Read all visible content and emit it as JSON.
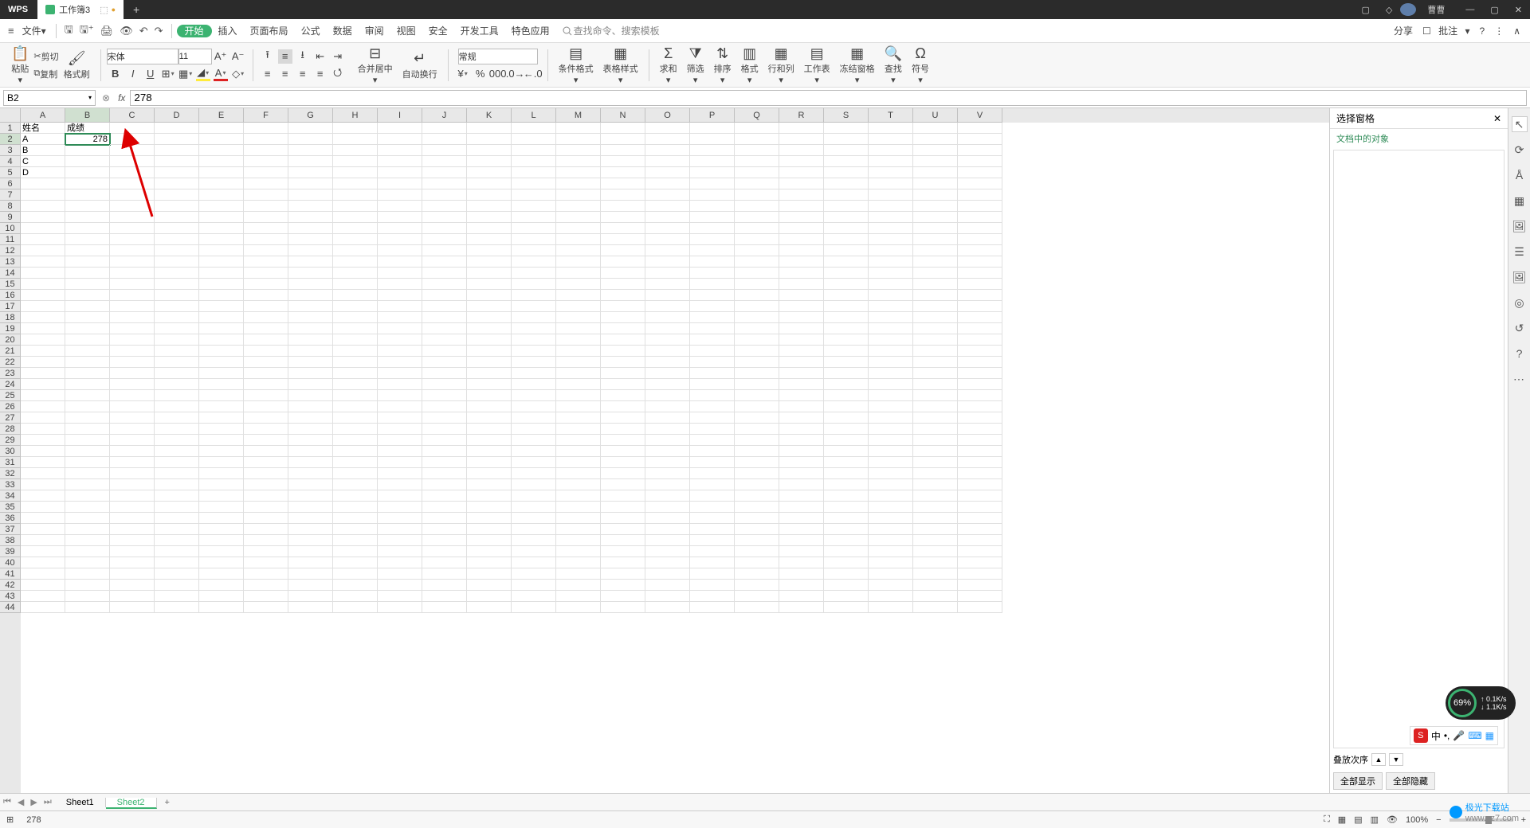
{
  "title": {
    "app": "WPS",
    "workbook": "工作簿3",
    "user": "曹曹"
  },
  "menu": {
    "file": "文件",
    "tabs": [
      "开始",
      "插入",
      "页面布局",
      "公式",
      "数据",
      "审阅",
      "视图",
      "安全",
      "开发工具",
      "特色应用"
    ],
    "search_placeholder": "查找命令、搜索模板",
    "share": "分享",
    "comment": "批注"
  },
  "ribbon": {
    "paste": "粘贴",
    "cut": "剪切",
    "copy": "复制",
    "format_painter": "格式刷",
    "font_name": "宋体",
    "font_size": "11",
    "merge_center": "合并居中",
    "wrap": "自动换行",
    "number_format": "常规",
    "cond_format": "条件格式",
    "table_style": "表格样式",
    "sum": "求和",
    "filter": "筛选",
    "sort": "排序",
    "format": "格式",
    "rowcol": "行和列",
    "sheet": "工作表",
    "freeze": "冻结窗格",
    "find": "查找",
    "symbol": "符号"
  },
  "formula": {
    "cell_ref": "B2",
    "value": "278"
  },
  "columns": [
    "A",
    "B",
    "C",
    "D",
    "E",
    "F",
    "G",
    "H",
    "I",
    "J",
    "K",
    "L",
    "M",
    "N",
    "O",
    "P",
    "Q",
    "R",
    "S",
    "T",
    "U",
    "V"
  ],
  "row_count": 44,
  "cells": {
    "A1": "姓名",
    "B1": "成绩",
    "A2": "A",
    "B2": "278",
    "A3": "B",
    "A4": "C",
    "A5": "D"
  },
  "active_cell": "B2",
  "sheets": {
    "list": [
      "Sheet1",
      "Sheet2"
    ],
    "active": "Sheet2"
  },
  "status": {
    "value": "278",
    "zoom": "100%"
  },
  "rpanel": {
    "title": "选择窗格",
    "subtitle": "文档中的对象",
    "stack_order": "叠放次序",
    "show_all": "全部显示",
    "hide_all": "全部隐藏"
  },
  "netwidget": {
    "pct": "69%",
    "up": "0.1K/s",
    "down": "1.1K/s"
  },
  "ime": {
    "lang": "中"
  },
  "watermark": {
    "brand": "极光下载站",
    "url": "www.xz7.com"
  }
}
